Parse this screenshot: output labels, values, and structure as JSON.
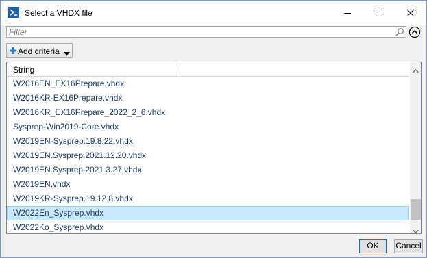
{
  "window": {
    "title": "Select a VHDX file"
  },
  "filter": {
    "placeholder": "Filter"
  },
  "toolbar": {
    "add_criteria_label": "Add criteria"
  },
  "list": {
    "columns": [
      "String",
      ""
    ],
    "rows": [
      "W2016EN_EX16Prepare.vhdx",
      "W2016KR-EX16Prepare.vhdx",
      "W2016KR_EX16Prepare_2022_2_6.vhdx",
      "Sysprep-Win2019-Core.vhdx",
      "W2019EN-Sysprep.19.8.22.vhdx",
      "W2019EN.Sysprep.2021.12.20.vhdx",
      "W2019EN.Sysprep.2021.3.27.vhdx",
      "W2019EN.vhdx",
      "W2019KR-Sysprep.19.12.8.vhdx",
      "W2022En_Sysprep.vhdx",
      "W2022Ko_Sysprep.vhdx"
    ],
    "selected_row": "W2022En_Sysprep.vhdx"
  },
  "buttons": {
    "ok_label": "OK",
    "cancel_label": "Cancel"
  },
  "colors": {
    "selection_bg": "#cce8ff",
    "selection_border": "#99d1ff",
    "row_text": "#1f3e6c",
    "app_icon": "#1d5fae"
  },
  "icons": {
    "app": "powershell-icon",
    "search": "search-icon",
    "collapse": "chevron-up-circle-icon",
    "add": "plus-icon",
    "dropdown": "caret-down-icon"
  }
}
